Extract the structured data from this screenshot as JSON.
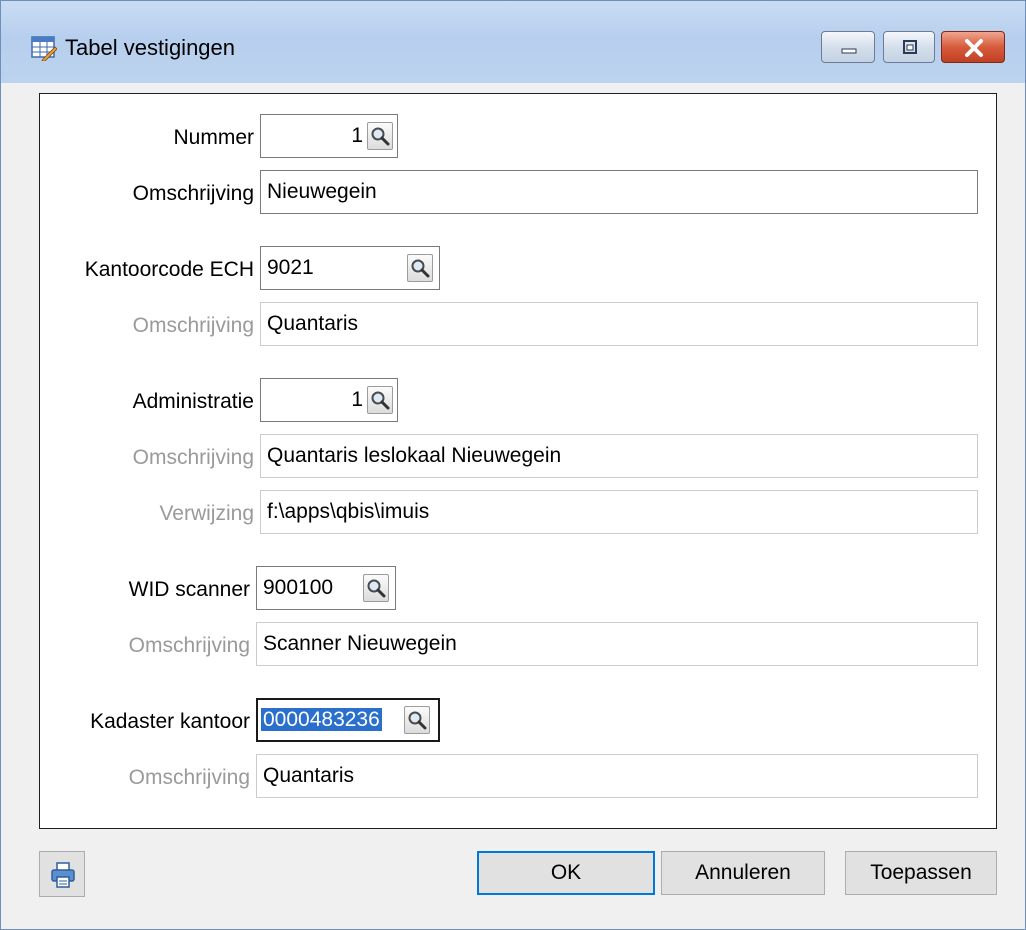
{
  "window": {
    "title": "Tabel vestigingen",
    "icons": {
      "app": "table-edit-icon",
      "minimize": "minimize-icon",
      "maximize": "maximize-icon",
      "close": "close-icon"
    }
  },
  "form": {
    "nummer": {
      "label": "Nummer",
      "value": "1",
      "lookup_icon": "search-icon"
    },
    "omschrijving": {
      "label": "Omschrijving",
      "value": "Nieuwegein"
    },
    "kantoorcode_ech": {
      "label": "Kantoorcode ECH",
      "value": "9021",
      "lookup_icon": "search-icon"
    },
    "kantoorcode_omschrijving": {
      "label": "Omschrijving",
      "value": "Quantaris"
    },
    "administratie": {
      "label": "Administratie",
      "value": "1",
      "lookup_icon": "search-icon"
    },
    "administratie_omschrijving": {
      "label": "Omschrijving",
      "value": "Quantaris leslokaal Nieuwegein"
    },
    "verwijzing": {
      "label": "Verwijzing",
      "value": "f:\\apps\\qbis\\imuis"
    },
    "wid_scanner": {
      "label": "WID scanner",
      "value": "900100",
      "lookup_icon": "search-icon"
    },
    "wid_scanner_omschrijving": {
      "label": "Omschrijving",
      "value": "Scanner Nieuwegein"
    },
    "kadaster_kantoor": {
      "label": "Kadaster kantoor",
      "value": "0000483236",
      "lookup_icon": "search-icon"
    },
    "kadaster_omschrijving": {
      "label": "Omschrijving",
      "value": "Quantaris"
    }
  },
  "buttons": {
    "print_icon": "printer-icon",
    "ok": "OK",
    "cancel": "Annuleren",
    "apply": "Toepassen"
  },
  "colors": {
    "selection": "#2a6fcc",
    "default_button_border": "#0078d7",
    "disabled_label": "#9a9a9a"
  }
}
